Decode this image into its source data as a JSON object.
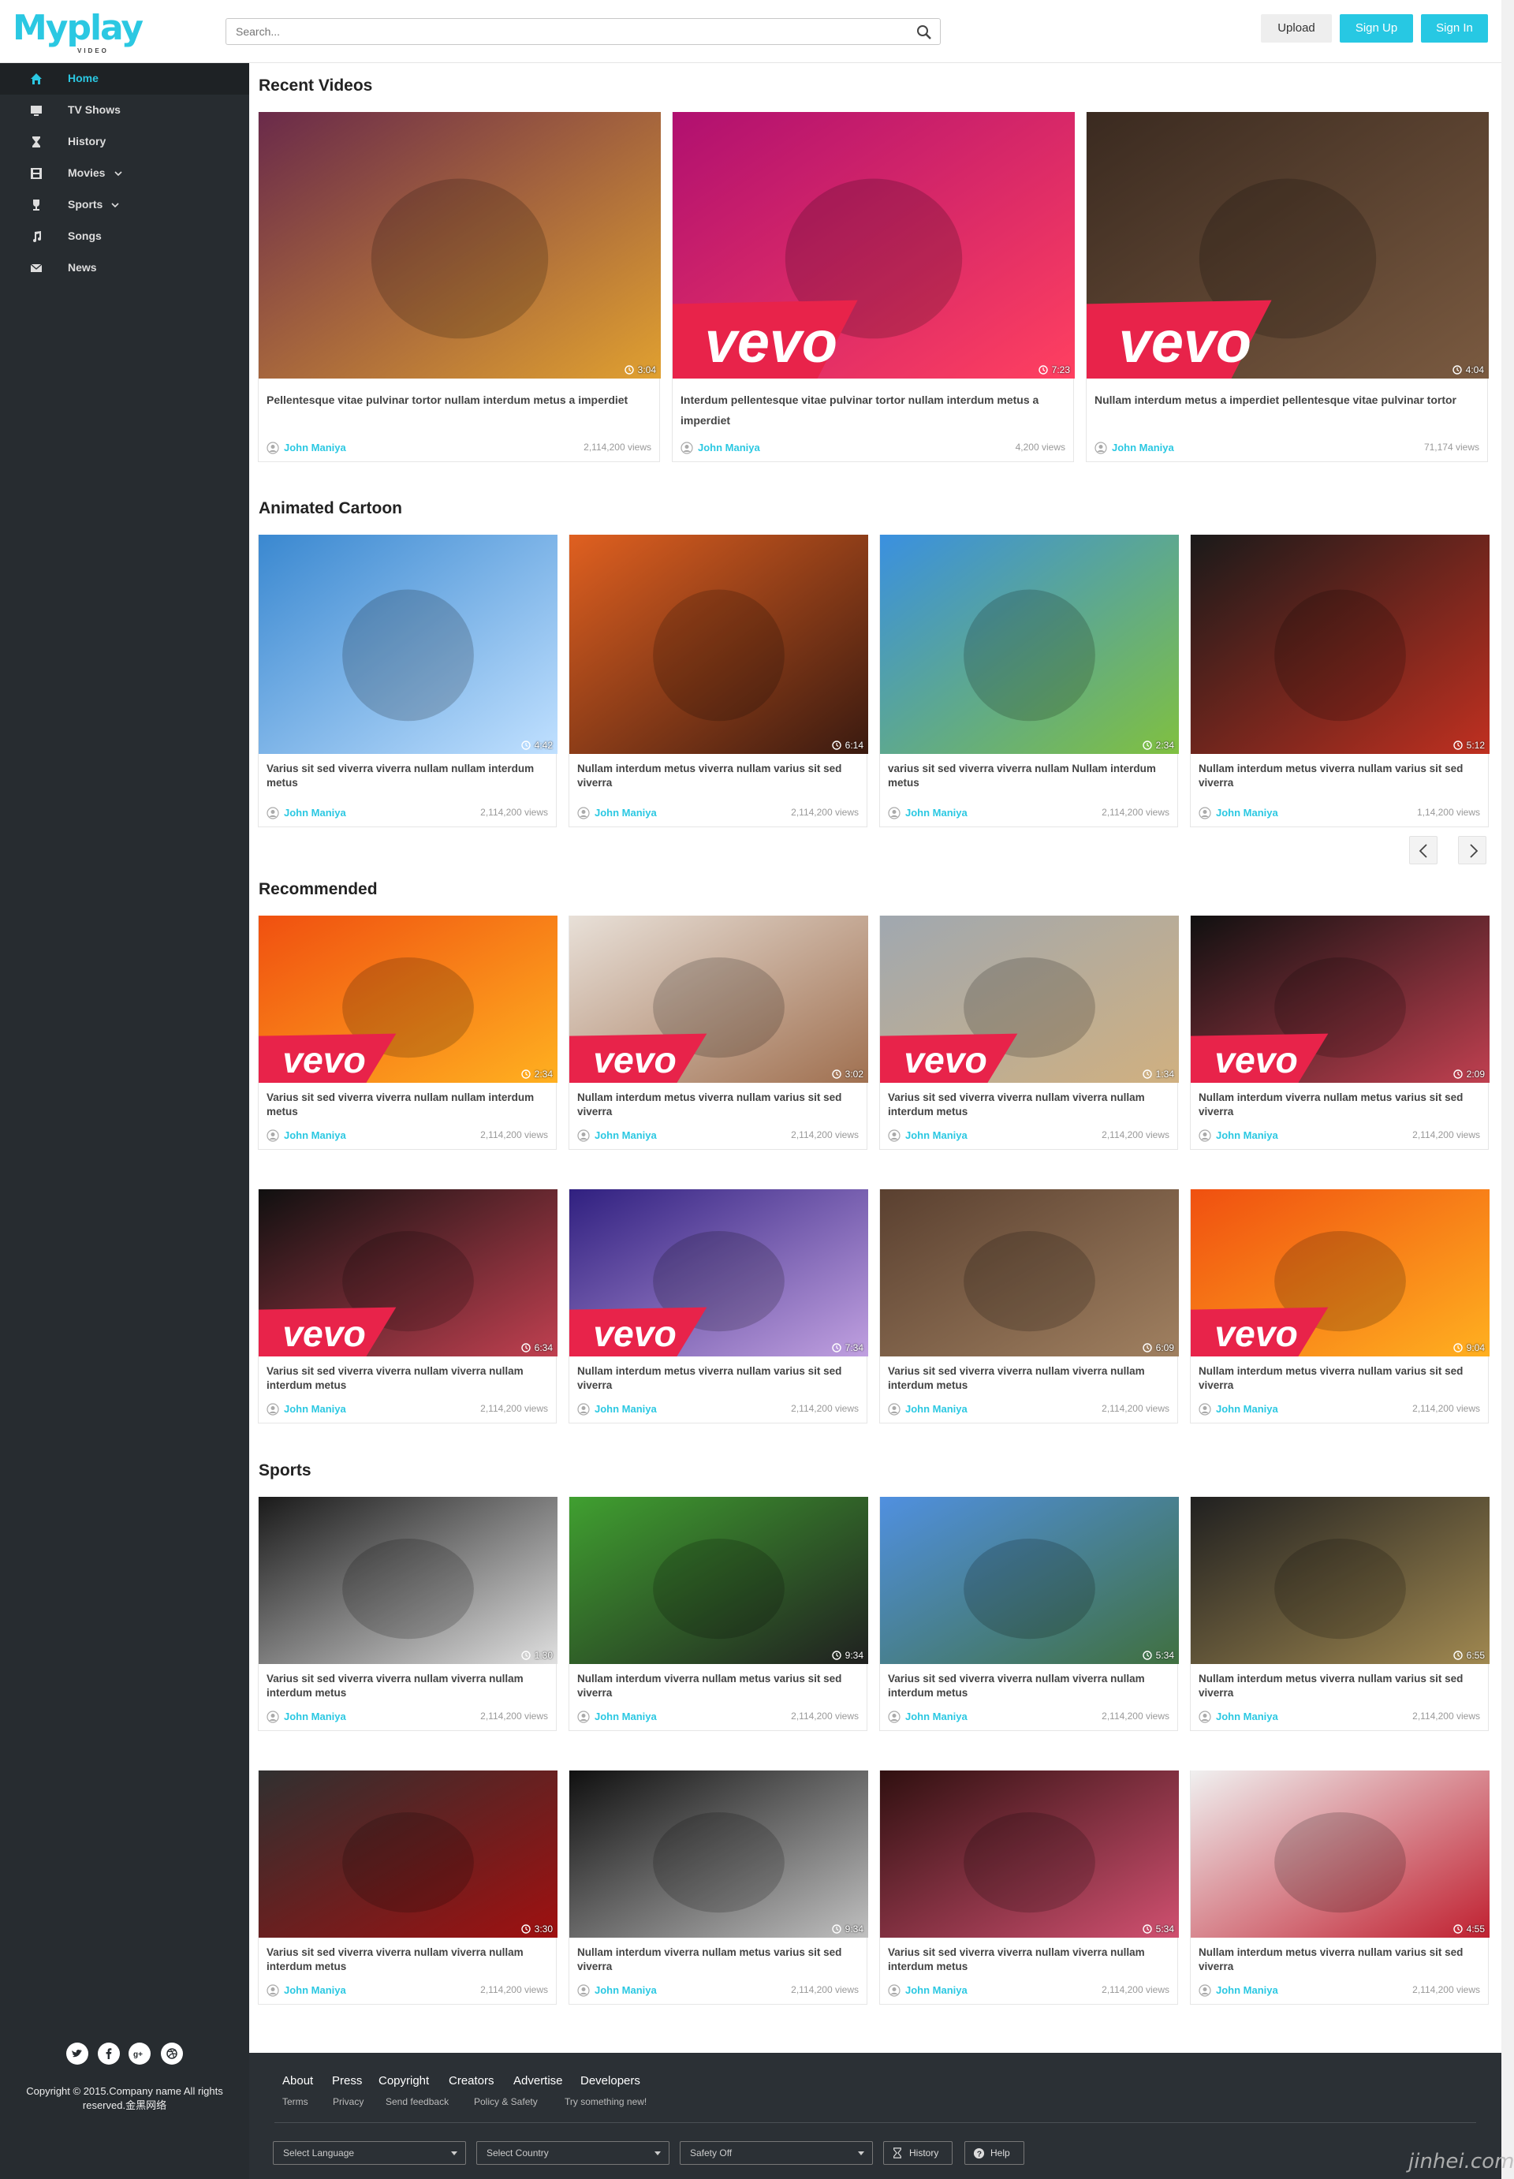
{
  "header": {
    "logo_main": "Myplay",
    "logo_sub": "VIDEO",
    "search_placeholder": "Search...",
    "upload_label": "Upload",
    "signup_label": "Sign Up",
    "signin_label": "Sign In"
  },
  "sidebar": {
    "items": [
      {
        "label": "Home",
        "icon": "home-icon",
        "active": true
      },
      {
        "label": "TV Shows",
        "icon": "tv-icon"
      },
      {
        "label": "History",
        "icon": "hourglass-icon"
      },
      {
        "label": "Movies",
        "icon": "film-icon",
        "dropdown": true
      },
      {
        "label": "Sports",
        "icon": "trophy-icon",
        "dropdown": true
      },
      {
        "label": "Songs",
        "icon": "music-icon"
      },
      {
        "label": "News",
        "icon": "envelope-icon"
      }
    ],
    "social": [
      "twitter-icon",
      "facebook-icon",
      "google-plus-icon",
      "dribbble-icon"
    ],
    "copyright": "Copyright © 2015.Company name All rights reserved.金黑网络"
  },
  "sections": {
    "recent": {
      "title": "Recent Videos",
      "cards": [
        {
          "title": "Pellentesque vitae pulvinar tortor nullam interdum metus a imperdiet",
          "author": "John Maniya",
          "views": "2,114,200 views",
          "duration": "3:04"
        },
        {
          "title": "Interdum pellentesque vitae pulvinar tortor nullam interdum metus a imperdiet",
          "author": "John Maniya",
          "views": "4,200 views",
          "duration": "7:23"
        },
        {
          "title": "Nullam interdum metus a imperdiet pellentesque vitae pulvinar tortor",
          "author": "John Maniya",
          "views": "71,174 views",
          "duration": "4:04"
        }
      ]
    },
    "cartoon": {
      "title": "Animated Cartoon",
      "cards": [
        {
          "title": "Varius sit sed viverra viverra nullam nullam interdum metus",
          "author": "John Maniya",
          "views": "2,114,200 views",
          "duration": "4:42"
        },
        {
          "title": "Nullam interdum metus viverra nullam varius sit sed viverra",
          "author": "John Maniya",
          "views": "2,114,200 views",
          "duration": "6:14"
        },
        {
          "title": "varius sit sed viverra viverra nullam Nullam interdum metus",
          "author": "John Maniya",
          "views": "2,114,200 views",
          "duration": "2:34"
        },
        {
          "title": "Nullam interdum metus viverra nullam varius sit sed viverra",
          "author": "John Maniya",
          "views": "1,14,200 views",
          "duration": "5:12"
        }
      ]
    },
    "recommended": {
      "title": "Recommended",
      "cards": [
        {
          "title": "Varius sit sed viverra viverra nullam nullam interdum metus",
          "author": "John Maniya",
          "views": "2,114,200 views",
          "duration": "2:34"
        },
        {
          "title": "Nullam interdum metus viverra nullam varius sit sed viverra",
          "author": "John Maniya",
          "views": "2,114,200 views",
          "duration": "3:02"
        },
        {
          "title": "Varius sit sed viverra viverra nullam viverra nullam interdum metus",
          "author": "John Maniya",
          "views": "2,114,200 views",
          "duration": "1:34"
        },
        {
          "title": "Nullam interdum viverra nullam metus varius sit sed viverra",
          "author": "John Maniya",
          "views": "2,114,200 views",
          "duration": "2:09"
        },
        {
          "title": "Varius sit sed viverra viverra nullam viverra nullam interdum metus",
          "author": "John Maniya",
          "views": "2,114,200 views",
          "duration": "6:34"
        },
        {
          "title": "Nullam interdum metus viverra nullam varius sit sed viverra",
          "author": "John Maniya",
          "views": "2,114,200 views",
          "duration": "7:34"
        },
        {
          "title": "Varius sit sed viverra viverra nullam viverra nullam interdum metus",
          "author": "John Maniya",
          "views": "2,114,200 views",
          "duration": "6:09"
        },
        {
          "title": "Nullam interdum metus viverra nullam varius sit sed viverra",
          "author": "John Maniya",
          "views": "2,114,200 views",
          "duration": "9:04"
        }
      ]
    },
    "sports": {
      "title": "Sports",
      "cards": [
        {
          "title": "Varius sit sed viverra viverra nullam viverra nullam interdum metus",
          "author": "John Maniya",
          "views": "2,114,200 views",
          "duration": "1:30"
        },
        {
          "title": "Nullam interdum viverra nullam metus varius sit sed viverra",
          "author": "John Maniya",
          "views": "2,114,200 views",
          "duration": "9:34"
        },
        {
          "title": "Varius sit sed viverra viverra nullam viverra nullam interdum metus",
          "author": "John Maniya",
          "views": "2,114,200 views",
          "duration": "5:34"
        },
        {
          "title": "Nullam interdum metus viverra nullam varius sit sed viverra",
          "author": "John Maniya",
          "views": "2,114,200 views",
          "duration": "6:55"
        },
        {
          "title": "Varius sit sed viverra viverra nullam viverra nullam interdum metus",
          "author": "John Maniya",
          "views": "2,114,200 views",
          "duration": "3:30"
        },
        {
          "title": "Nullam interdum viverra nullam metus varius sit sed viverra",
          "author": "John Maniya",
          "views": "2,114,200 views",
          "duration": "9:34"
        },
        {
          "title": "Varius sit sed viverra viverra nullam viverra nullam interdum metus",
          "author": "John Maniya",
          "views": "2,114,200 views",
          "duration": "5:34"
        },
        {
          "title": "Nullam interdum metus viverra nullam varius sit sed viverra",
          "author": "John Maniya",
          "views": "2,114,200 views",
          "duration": "4:55"
        }
      ]
    }
  },
  "thumb_colors": {
    "recent": [
      [
        "#6a2a4a",
        "#e0a030"
      ],
      [
        "#b01070",
        "#ff4060"
      ],
      [
        "#3a2a20",
        "#7a5a40"
      ]
    ],
    "cartoon": [
      [
        "#3a88d0",
        "#c0e0ff"
      ],
      [
        "#e06020",
        "#3a1a10"
      ],
      [
        "#3a90e0",
        "#80c040"
      ],
      [
        "#1a1a1a",
        "#c03020"
      ]
    ],
    "recommended": [
      [
        "#f05010",
        "#ffb020"
      ],
      [
        "#e8e0d8",
        "#a07050"
      ],
      [
        "#a0a8b0",
        "#d0b080"
      ],
      [
        "#101010",
        "#c04050"
      ],
      [
        "#101010",
        "#c04050"
      ],
      [
        "#302080",
        "#c0a0e0"
      ],
      [
        "#5a4030",
        "#a08060"
      ],
      [
        "#f05010",
        "#ffb020"
      ]
    ],
    "sports": [
      [
        "#1a1a1a",
        "#e0e0e0"
      ],
      [
        "#40a030",
        "#202020"
      ],
      [
        "#5090e0",
        "#407040"
      ],
      [
        "#202020",
        "#a08850"
      ],
      [
        "#303030",
        "#a01010"
      ],
      [
        "#101010",
        "#c0c0c0"
      ],
      [
        "#301010",
        "#d05070"
      ],
      [
        "#f0f0f0",
        "#c02030"
      ]
    ]
  },
  "vevo_label": "vevo",
  "pagination": {
    "prev": "prev-arrow-icon",
    "next": "next-arrow-icon"
  },
  "footer": {
    "links": [
      "About",
      "Press",
      "Copyright",
      "Creators",
      "Advertise",
      "Developers"
    ],
    "sublinks": [
      "Terms",
      "Privacy",
      "Send feedback",
      "Policy & Safety",
      "Try something new!"
    ],
    "selects": [
      "Select Language",
      "Select Country",
      "Safety Off"
    ],
    "history_label": "History",
    "help_label": "Help"
  },
  "watermark": "jinhei.com",
  "colors": {
    "accent": "#27c8e3",
    "sidebar": "#272c30",
    "footer": "#2b3035"
  }
}
